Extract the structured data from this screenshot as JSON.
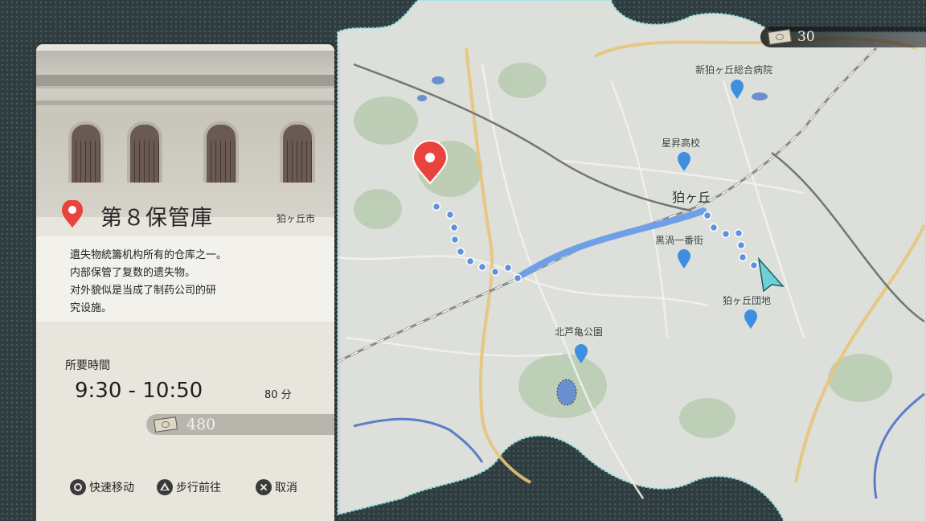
{
  "hud": {
    "money": "30"
  },
  "map": {
    "area_label": "狛ヶ丘",
    "places": [
      {
        "name": "新狛ヶ丘総合病院"
      },
      {
        "name": "星昇高校"
      },
      {
        "name": "黒渦一番街"
      },
      {
        "name": "狛ヶ丘団地"
      },
      {
        "name": "北芦亀公園"
      }
    ]
  },
  "location": {
    "title": "第８保管庫",
    "city": "狛ヶ丘市",
    "description_lines": [
      "遺失物統籌机构所有的仓库之一。",
      "内部保管了复数的遗失物。",
      "对外貌似是当成了制药公司的研",
      "究设施。"
    ],
    "time_label": "所要時間",
    "time_range": "9:30  -  10:50",
    "duration": "80 分",
    "cost": "480"
  },
  "actions": {
    "fast_travel": "快速移动",
    "walk": "步行前往",
    "cancel": "取消"
  },
  "colors": {
    "route": "#6e9fe8",
    "pin_blue": "#3f8fe0",
    "pin_red": "#e8433d",
    "cursor": "#6fd0d6"
  }
}
